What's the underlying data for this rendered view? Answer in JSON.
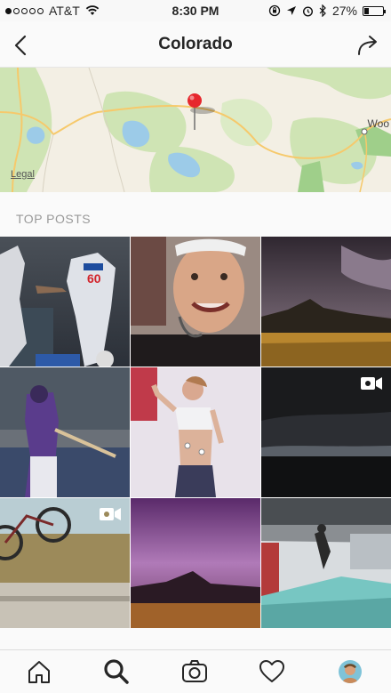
{
  "status_bar": {
    "carrier": "AT&T",
    "time": "8:30 PM",
    "battery_percent": "27%",
    "battery_level": 0.27,
    "signal_bars_filled": 1,
    "signal_bars_total": 5
  },
  "nav": {
    "title": "Colorado",
    "back_icon": "chevron-left-icon",
    "share_icon": "share-arrow-icon"
  },
  "map": {
    "legal_label": "Legal",
    "city_label": "Woo"
  },
  "section": {
    "title": "TOP POSTS"
  },
  "posts": [
    {
      "subject": "baseball players high-five",
      "is_video": false
    },
    {
      "subject": "selfie",
      "is_video": false
    },
    {
      "subject": "storm over mountains",
      "is_video": false
    },
    {
      "subject": "baseball batter",
      "is_video": false
    },
    {
      "subject": "woman with electrodes",
      "is_video": false
    },
    {
      "subject": "dark storm clouds",
      "is_video": true
    },
    {
      "subject": "bmx bike",
      "is_video": true
    },
    {
      "subject": "purple storm sky",
      "is_video": false
    },
    {
      "subject": "skate park",
      "is_video": false
    }
  ],
  "tabs": [
    {
      "name": "home",
      "icon": "home-icon"
    },
    {
      "name": "search",
      "icon": "search-icon",
      "active": true
    },
    {
      "name": "camera",
      "icon": "camera-icon"
    },
    {
      "name": "activity",
      "icon": "heart-icon"
    },
    {
      "name": "profile",
      "icon": "avatar"
    }
  ]
}
